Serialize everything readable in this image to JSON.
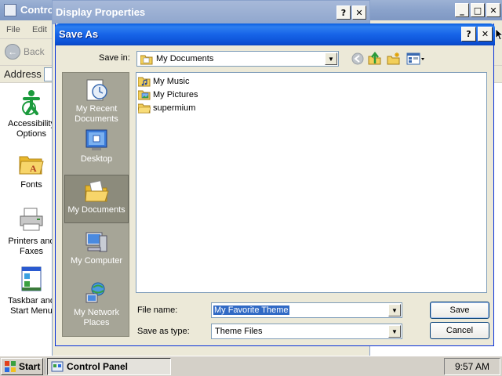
{
  "control_panel": {
    "title": "Contro",
    "menu": [
      "File",
      "Edit"
    ],
    "back_label": "Back",
    "address_label": "Address",
    "items": [
      {
        "label": "Accessibility Options",
        "icon": "accessibility-icon"
      },
      {
        "label": "Fonts",
        "icon": "fonts-folder-icon"
      },
      {
        "label": "Printers and Faxes",
        "icon": "printer-icon"
      },
      {
        "label": "Taskbar and Start Menu",
        "icon": "taskbar-icon"
      }
    ]
  },
  "display_properties": {
    "title": "Display Properties"
  },
  "save_as": {
    "title": "Save As",
    "save_in_label": "Save in:",
    "save_in_value": "My Documents",
    "places": [
      {
        "label": "My Recent Documents",
        "icon": "recent-documents-icon"
      },
      {
        "label": "Desktop",
        "icon": "desktop-icon"
      },
      {
        "label": "My Documents",
        "icon": "my-documents-icon",
        "active": true
      },
      {
        "label": "My Computer",
        "icon": "my-computer-icon"
      },
      {
        "label": "My Network Places",
        "icon": "network-places-icon"
      }
    ],
    "files": [
      {
        "name": "My Music",
        "icon": "music-folder-icon"
      },
      {
        "name": "My Pictures",
        "icon": "pictures-folder-icon"
      },
      {
        "name": "supermium",
        "icon": "folder-icon"
      }
    ],
    "file_name_label": "File name:",
    "file_name_value": "My Favorite Theme",
    "save_as_type_label": "Save as type:",
    "save_as_type_value": "Theme Files",
    "save_button": "Save",
    "cancel_button": "Cancel"
  },
  "taskbar": {
    "start_label": "Start",
    "task_label": "Control Panel",
    "clock": "9:57 AM"
  },
  "colors": {
    "titlebar_active": "#0b4fd3",
    "selection": "#316ac5",
    "dialog_face": "#ece9d8",
    "places_bar": "#a6a597"
  }
}
